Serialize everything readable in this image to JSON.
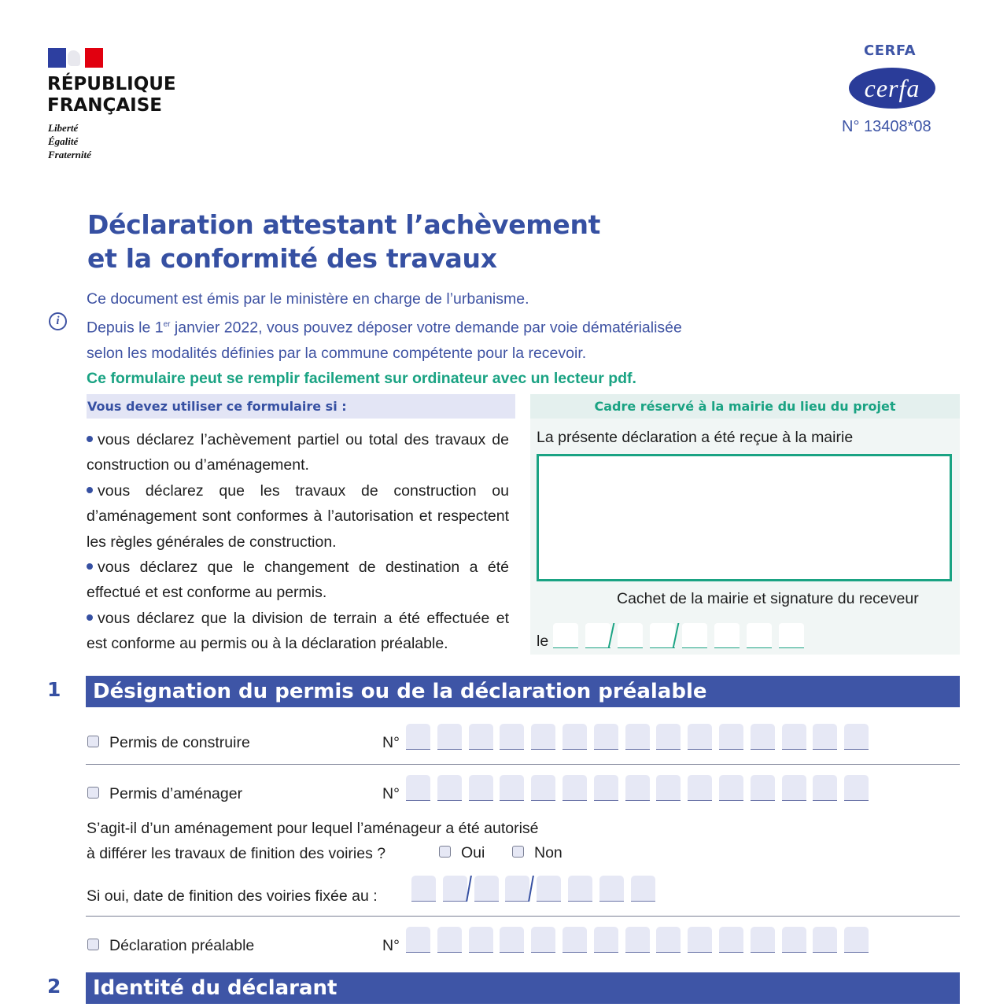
{
  "header": {
    "republic_line1": "RÉPUBLIQUE",
    "republic_line2": "FRANÇAISE",
    "motto": [
      "Liberté",
      "Égalité",
      "Fraternité"
    ],
    "cerfa_label": "CERFA",
    "cerfa_logo_text": "cerfa",
    "cerfa_number": "N° 13408*08"
  },
  "title": {
    "line1": "Déclaration attestant l’achèvement",
    "line2": "et la conformité des travaux"
  },
  "intro": {
    "line1": "Ce document est émis par le ministère en charge de l’urbanisme.",
    "line2_pre": "Depuis le 1",
    "line2_sup": "er",
    "line2_post": " janvier 2022, vous pouvez déposer votre demande par voie dématérialisée",
    "line3": "selon les modalités définies par la commune compétente pour la recevoir.",
    "line4": "Ce formulaire peut se remplir facilement sur ordinateur avec un lecteur pdf.",
    "info_icon": "i"
  },
  "usage": {
    "header": "Vous devez utiliser ce formulaire si :",
    "items": [
      "vous déclarez l’achèvement partiel ou total des travaux de construction ou d’aménagement.",
      "vous déclarez que les travaux de construction ou d’aménagement sont conformes à l’autorisation et respectent les règles générales de construction.",
      "vous déclarez que le changement de destination a été effectué et est conforme au permis.",
      "vous déclarez que la division de terrain a été effectuée et est conforme au permis ou à la déclaration préalable."
    ]
  },
  "mairie": {
    "header": "Cadre réservé à la mairie du lieu du projet",
    "received": "La présente déclaration a été reçue à la mairie",
    "stamp_caption": "Cachet de la mairie et signature du receveur",
    "date_label": "le",
    "date_value": ""
  },
  "section1": {
    "number": "1",
    "title": "Désignation du permis ou de la déclaration préalable",
    "permis_construire": {
      "label": "Permis de construire",
      "checked": false,
      "num_label": "N°",
      "value": ""
    },
    "permis_amenager": {
      "label": "Permis d’aménager",
      "checked": false,
      "num_label": "N°",
      "value": ""
    },
    "question_line1": "S’agit-il d’un aménagement pour lequel l’aménageur a été autorisé",
    "question_line2": "à différer les travaux de finition des voiries ?",
    "oui_label": "Oui",
    "non_label": "Non",
    "date_label": "Si oui, date de finition des voiries fixée au :",
    "date_value": "",
    "declaration_prealable": {
      "label": "Déclaration préalable",
      "checked": false,
      "num_label": "N°",
      "value": ""
    }
  },
  "section2": {
    "number": "2",
    "title": "Identité du déclarant"
  },
  "colors": {
    "brand_blue": "#3e55a6",
    "title_blue": "#3650a2",
    "accent_green": "#1aa383",
    "field_fill": "#e6e8f5"
  }
}
